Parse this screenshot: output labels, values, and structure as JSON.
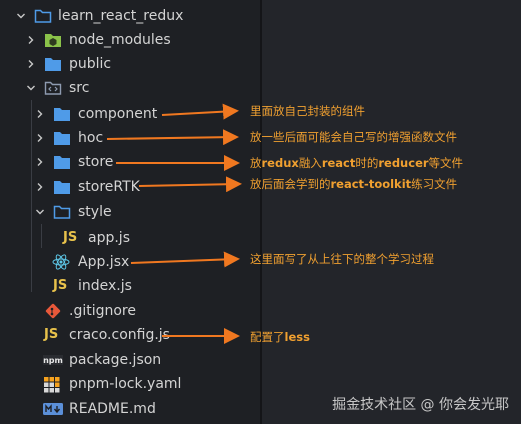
{
  "tree": {
    "root": "learn_react_redux",
    "items": [
      {
        "label": "node_modules"
      },
      {
        "label": "public"
      },
      {
        "label": "src"
      },
      {
        "label": "component"
      },
      {
        "label": "hoc"
      },
      {
        "label": "store"
      },
      {
        "label": "storeRTK"
      },
      {
        "label": "style"
      },
      {
        "label": "app.js"
      },
      {
        "label": "App.jsx"
      },
      {
        "label": "index.js"
      },
      {
        "label": ".gitignore"
      },
      {
        "label": "craco.config.js"
      },
      {
        "label": "package.json"
      },
      {
        "label": "pnpm-lock.yaml"
      },
      {
        "label": "README.md"
      }
    ]
  },
  "annotations": {
    "component": "里面放自己封装的组件",
    "hoc": "放一些后面可能会自己写的增强函数文件",
    "store_pre": "放",
    "store_b1": "redux",
    "store_mid1": "融入",
    "store_b2": "react",
    "store_mid2": "时的",
    "store_b3": "reducer",
    "store_post": "等文件",
    "storeRTK_pre": "放后面会学到的",
    "storeRTK_b": "react-toolkit",
    "storeRTK_post": "练习文件",
    "appjsx": "这里面写了从上往下的整个学习过程",
    "craco_pre": "配置了",
    "craco_b": "less"
  },
  "watermark": "掘金技术社区 @ 你会发光耶",
  "colors": {
    "folder": "#4f9be8",
    "accent_arrow": "#f07820",
    "annotation_text": "#f0a030",
    "js_icon": "#e8c24b",
    "react_icon": "#5ec8e8"
  }
}
